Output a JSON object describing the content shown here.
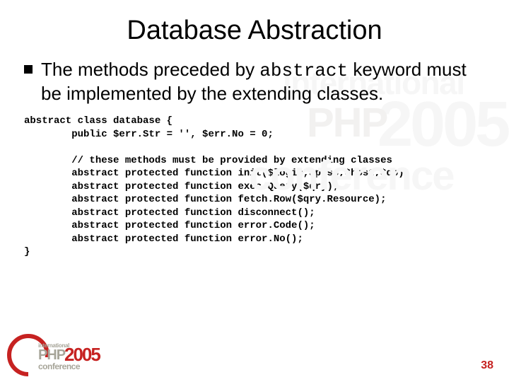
{
  "title": "Database Abstraction",
  "bullet": {
    "pre": "The methods preceded by ",
    "kw": "abstract",
    "post": " keyword must be implemented by the extending classes."
  },
  "code": "abstract class database {\n        public $err.Str = '', $err.No = 0;\n\n        // these methods must be provided by extending classes\n        abstract protected function init($login,$pass,$host,$db);\n        abstract protected function exec.Query($qry);\n        abstract protected function fetch.Row($qry.Resource);\n        abstract protected function disconnect();\n        abstract protected function error.Code();\n        abstract protected function error.No();\n}",
  "watermark": {
    "intl": "international",
    "php": "PHP",
    "year": "2005",
    "conf": "conference"
  },
  "logo": {
    "intl": "international",
    "php": "PHP",
    "year": "2005",
    "conf": "conference"
  },
  "page": "38"
}
